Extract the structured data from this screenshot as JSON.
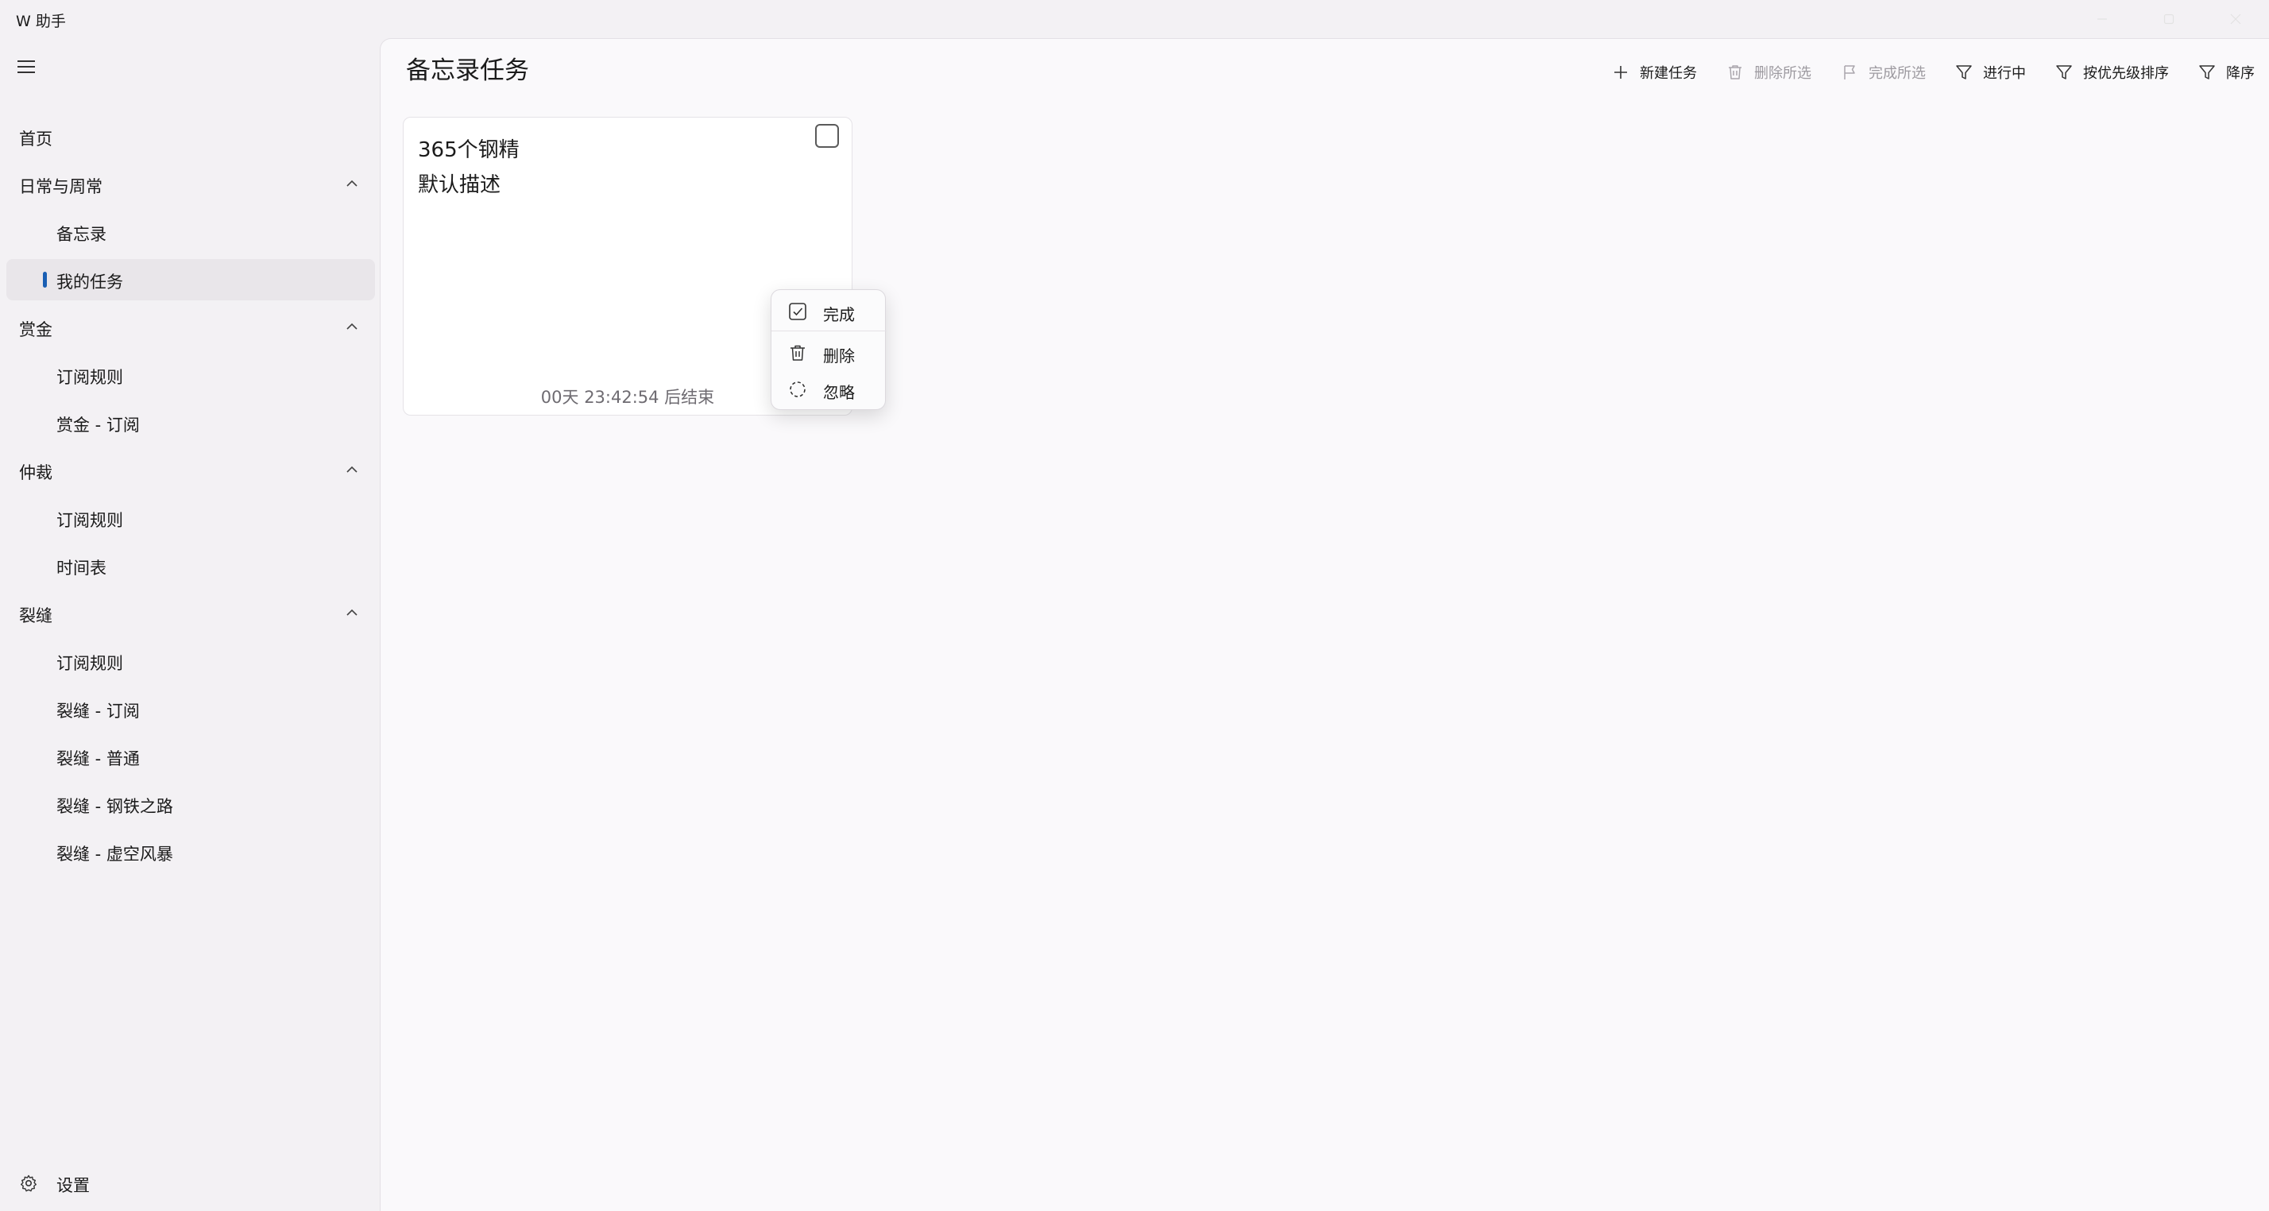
{
  "window": {
    "title": "W 助手"
  },
  "sidebar": {
    "menu_icon": "hamburger-icon",
    "items": [
      {
        "label": "首页",
        "level": "top"
      },
      {
        "label": "日常与周常",
        "level": "top",
        "expanded": true
      },
      {
        "label": "备忘录",
        "level": "sub"
      },
      {
        "label": "我的任务",
        "level": "sub",
        "selected": true
      },
      {
        "label": "赏金",
        "level": "top",
        "expanded": true
      },
      {
        "label": "订阅规则",
        "level": "sub"
      },
      {
        "label": "赏金 - 订阅",
        "level": "sub"
      },
      {
        "label": "仲裁",
        "level": "top",
        "expanded": true
      },
      {
        "label": "订阅规则",
        "level": "sub"
      },
      {
        "label": "时间表",
        "level": "sub"
      },
      {
        "label": "裂缝",
        "level": "top",
        "expanded": true
      },
      {
        "label": "订阅规则",
        "level": "sub"
      },
      {
        "label": "裂缝 - 订阅",
        "level": "sub"
      },
      {
        "label": "裂缝 - 普通",
        "level": "sub"
      },
      {
        "label": "裂缝 - 钢铁之路",
        "level": "sub"
      },
      {
        "label": "裂缝 - 虚空风暴",
        "level": "sub"
      }
    ],
    "settings_label": "设置",
    "settings_icon": "gear-icon"
  },
  "main": {
    "title": "备忘录任务",
    "toolbar": {
      "new_task": "新建任务",
      "delete_selected": "删除所选",
      "complete_selected": "完成所选",
      "filter_status": "进行中",
      "sort_priority": "按优先级排序",
      "order": "降序"
    },
    "task": {
      "title": "365个钢精",
      "description": "默认描述",
      "countdown": "00天 23:42:54 后结束"
    },
    "context_menu": {
      "complete": "完成",
      "delete": "删除",
      "ignore": "忽略"
    }
  },
  "colors": {
    "accent": "#1a5fb4",
    "sidebar_bg": "#f3f1f4",
    "content_bg": "#faf9fb",
    "disabled_text": "#9d9aa0"
  }
}
